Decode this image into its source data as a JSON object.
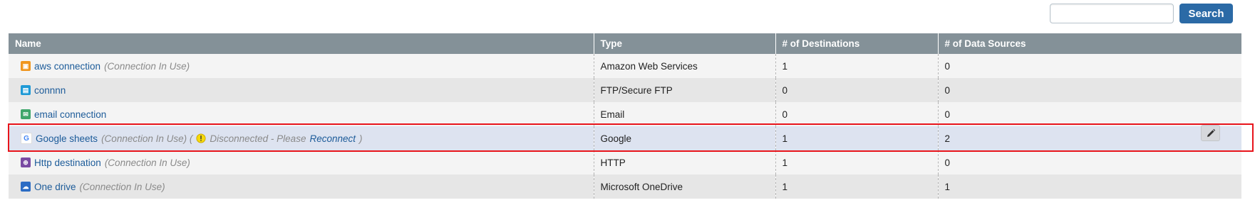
{
  "search": {
    "placeholder": "",
    "value": "",
    "button_label": "Search"
  },
  "table": {
    "headers": [
      "Name",
      "Type",
      "# of Destinations",
      "# of Data Sources"
    ],
    "rows": [
      {
        "name": "aws connection",
        "note": "(Connection In Use)",
        "type": "Amazon Web Services",
        "destinations": "1",
        "sources": "0",
        "icon": "aws-icon",
        "icon_color": "#f0961e"
      },
      {
        "name": "connnn",
        "note": "",
        "type": "FTP/Secure FTP",
        "destinations": "0",
        "sources": "0",
        "icon": "ftp-icon",
        "icon_color": "#1f9ad6"
      },
      {
        "name": "email connection",
        "note": "",
        "type": "Email",
        "destinations": "0",
        "sources": "0",
        "icon": "email-icon",
        "icon_color": "#3fa66b"
      },
      {
        "name": "Google sheets",
        "note": "(Connection In Use) (",
        "status": "Disconnected - Please",
        "reconnect": "Reconnect",
        "status_close": ")",
        "type": "Google",
        "destinations": "1",
        "sources": "2",
        "icon": "google-icon",
        "icon_color": "#ffffff"
      },
      {
        "name": "Http destination",
        "note": "(Connection In Use)",
        "type": "HTTP",
        "destinations": "1",
        "sources": "0",
        "icon": "http-icon",
        "icon_color": "#7a4ba3"
      },
      {
        "name": "One drive",
        "note": "(Connection In Use)",
        "type": "Microsoft OneDrive",
        "destinations": "1",
        "sources": "1",
        "icon": "onedrive-icon",
        "icon_color": "#2b6cc4"
      }
    ]
  },
  "colors": {
    "header_bg": "#849198",
    "link": "#1c5b99",
    "highlight": "#e8141b",
    "button": "#2b6aa6"
  }
}
